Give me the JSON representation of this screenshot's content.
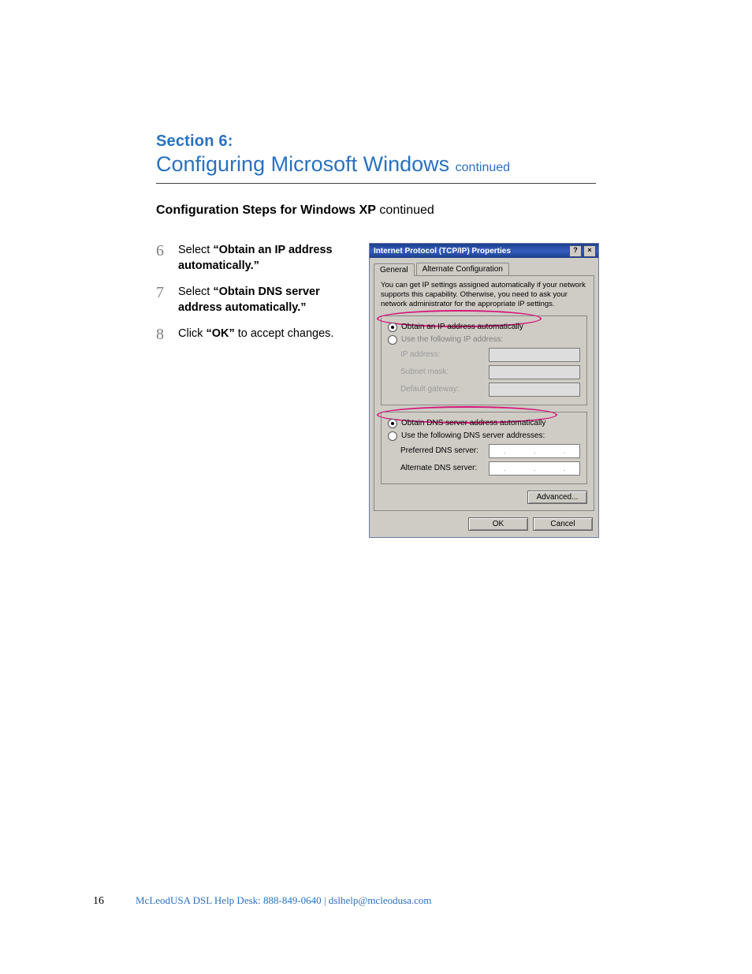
{
  "header": {
    "section_label": "Section 6:",
    "title": "Configuring Microsoft Windows",
    "title_suffix": "continued"
  },
  "subheading": {
    "bold": "Configuration Steps for Windows XP",
    "suffix": "continued"
  },
  "steps": [
    {
      "num": "6",
      "pre": "Select ",
      "bold": "“Obtain an IP address automatically.”",
      "post": ""
    },
    {
      "num": "7",
      "pre": "Select ",
      "bold": "“Obtain DNS server address automatically.”",
      "post": ""
    },
    {
      "num": "8",
      "pre": "Click ",
      "bold": "“OK”",
      "post": " to accept changes."
    }
  ],
  "dialog": {
    "title": "Internet Protocol (TCP/IP) Properties",
    "help_glyph": "?",
    "close_glyph": "×",
    "tabs": {
      "active": "General",
      "other": "Alternate Configuration"
    },
    "info_text": "You can get IP settings assigned automatically if your network supports this capability. Otherwise, you need to ask your network administrator for the appropriate IP settings.",
    "ip_group": {
      "opt_auto": "Obtain an IP address automatically",
      "opt_manual": "Use the following IP address:",
      "fields": {
        "ip_label": "IP address:",
        "mask_label": "Subnet mask:",
        "gw_label": "Default gateway:"
      }
    },
    "dns_group": {
      "opt_auto": "Obtain DNS server address automatically",
      "opt_manual": "Use the following DNS server addresses:",
      "fields": {
        "pref_label": "Preferred DNS server:",
        "alt_label": "Alternate DNS server:"
      }
    },
    "buttons": {
      "advanced": "Advanced...",
      "ok": "OK",
      "cancel": "Cancel"
    }
  },
  "footer": {
    "page": "16",
    "text_prefix": "McLeodUSA DSL Help Desk: ",
    "phone": "888-849-0640",
    "sep": "  |  ",
    "email": "dslhelp@mcleodusa.com"
  }
}
